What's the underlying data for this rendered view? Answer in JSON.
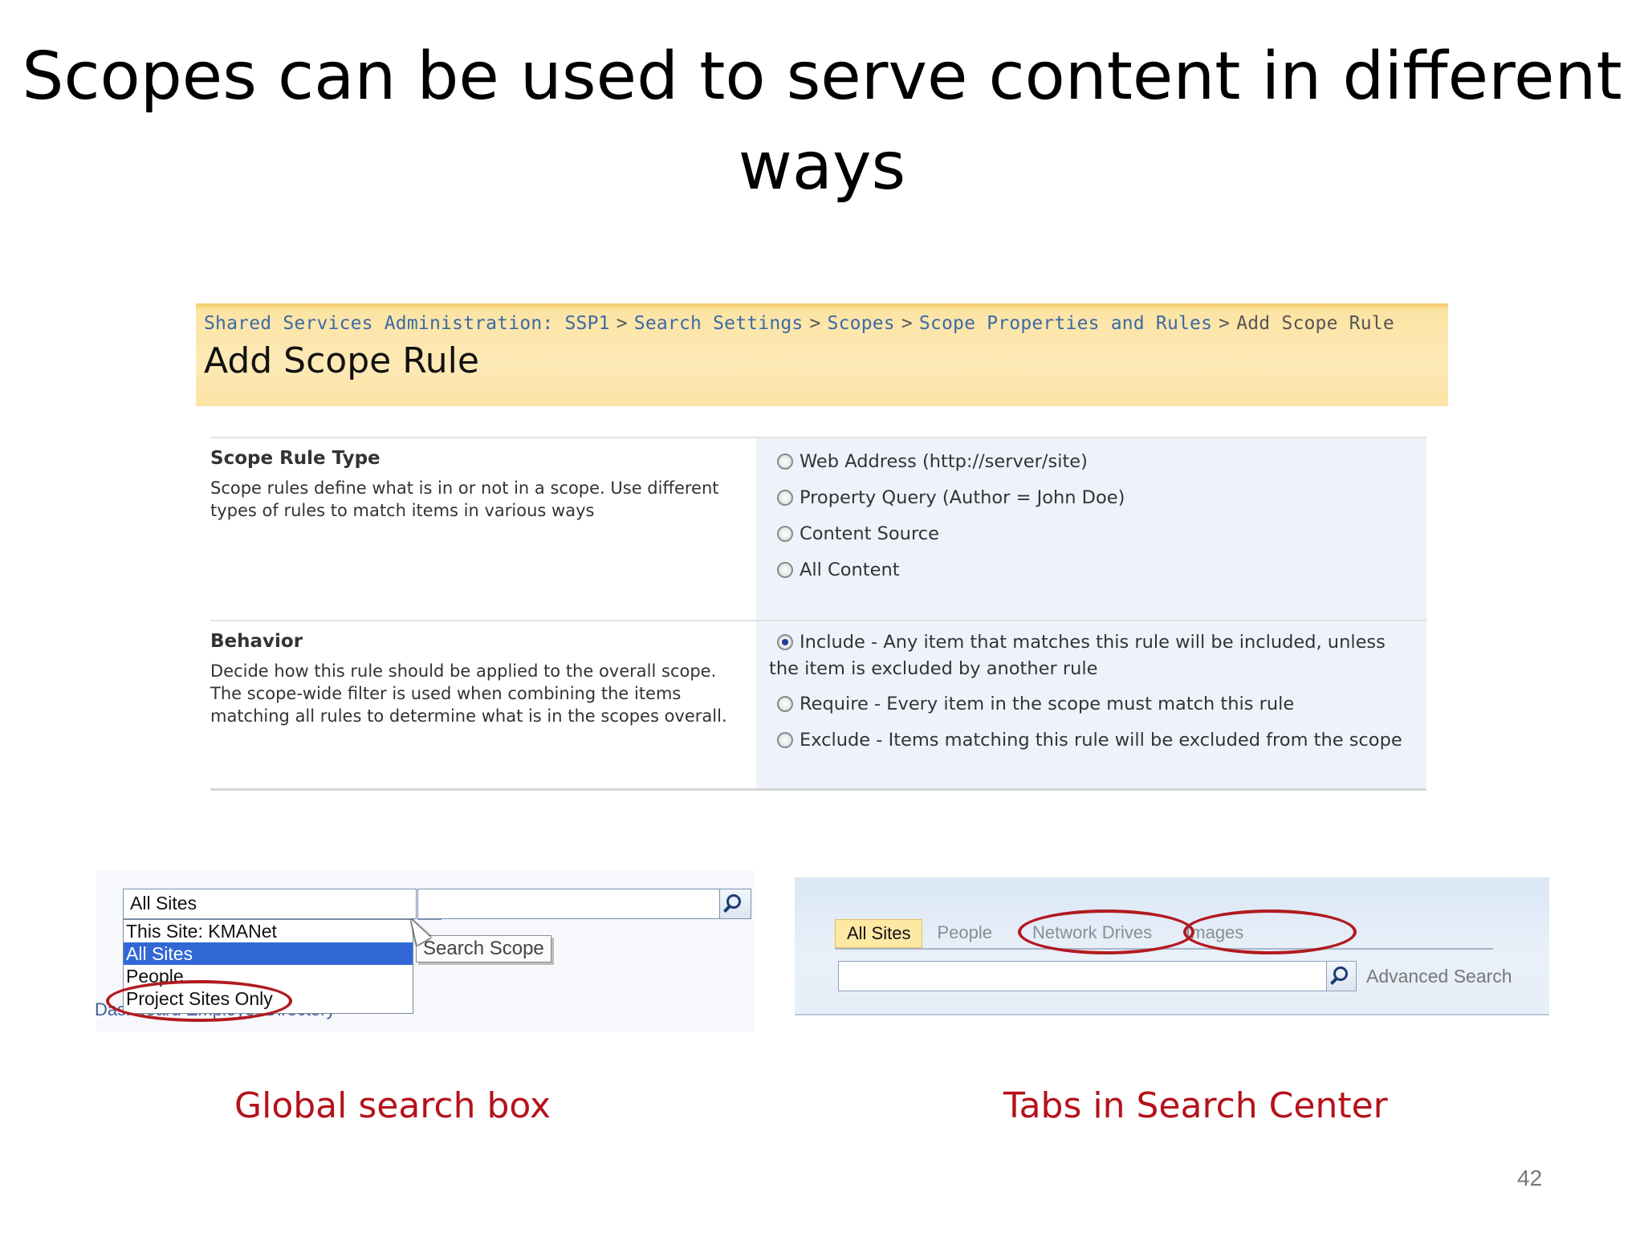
{
  "slide": {
    "title_line1": "Scopes can be used to serve content in different",
    "title_line2": "ways",
    "page_number": "42"
  },
  "add_scope_rule": {
    "breadcrumb": [
      "Shared Services Administration: SSP1",
      "Search Settings",
      "Scopes",
      "Scope Properties and Rules",
      "Add Scope Rule"
    ],
    "breadcrumb_separator": ">",
    "page_title": "Add Scope Rule",
    "scope_rule_type": {
      "title": "Scope Rule Type",
      "description": "Scope rules define what is in or not in a scope. Use different types of rules to match items in various ways",
      "options": [
        "Web Address (http://server/site)",
        "Property Query (Author = John Doe)",
        "Content Source",
        "All Content"
      ],
      "selected": null
    },
    "behavior": {
      "title": "Behavior",
      "description": "Decide how this rule should be applied to the overall scope. The scope-wide filter is used when combining the items matching all rules to determine what is in the scopes overall.",
      "options": [
        "Include - Any item that matches this rule will be included, unless the item is excluded by another rule",
        "Require - Every item in the scope must match this rule",
        "Exclude - Items matching this rule will be excluded from the scope"
      ],
      "selected": "Include - Any item that matches this rule will be included, unless the item is excluded by another rule"
    }
  },
  "global_search": {
    "scope_value": "All Sites",
    "dropdown_options": [
      "This Site: KMANet",
      "All Sites",
      "People",
      "Project Sites Only"
    ],
    "selected_option": "All Sites",
    "tooltip": "Search Scope",
    "background_links": "Dashboard     EmployeeDirectory",
    "caption": "Global search box"
  },
  "search_center": {
    "tabs": [
      "All Sites",
      "People",
      "Network Drives",
      "Images"
    ],
    "active_tab": "All Sites",
    "advanced_search": "Advanced Search",
    "caption": "Tabs in Search Center"
  },
  "colors": {
    "header_gold": "#fde9b6",
    "link_blue": "#3c6aa6",
    "highlight_red": "#b11a1f",
    "selected_blue": "#3168d5"
  }
}
